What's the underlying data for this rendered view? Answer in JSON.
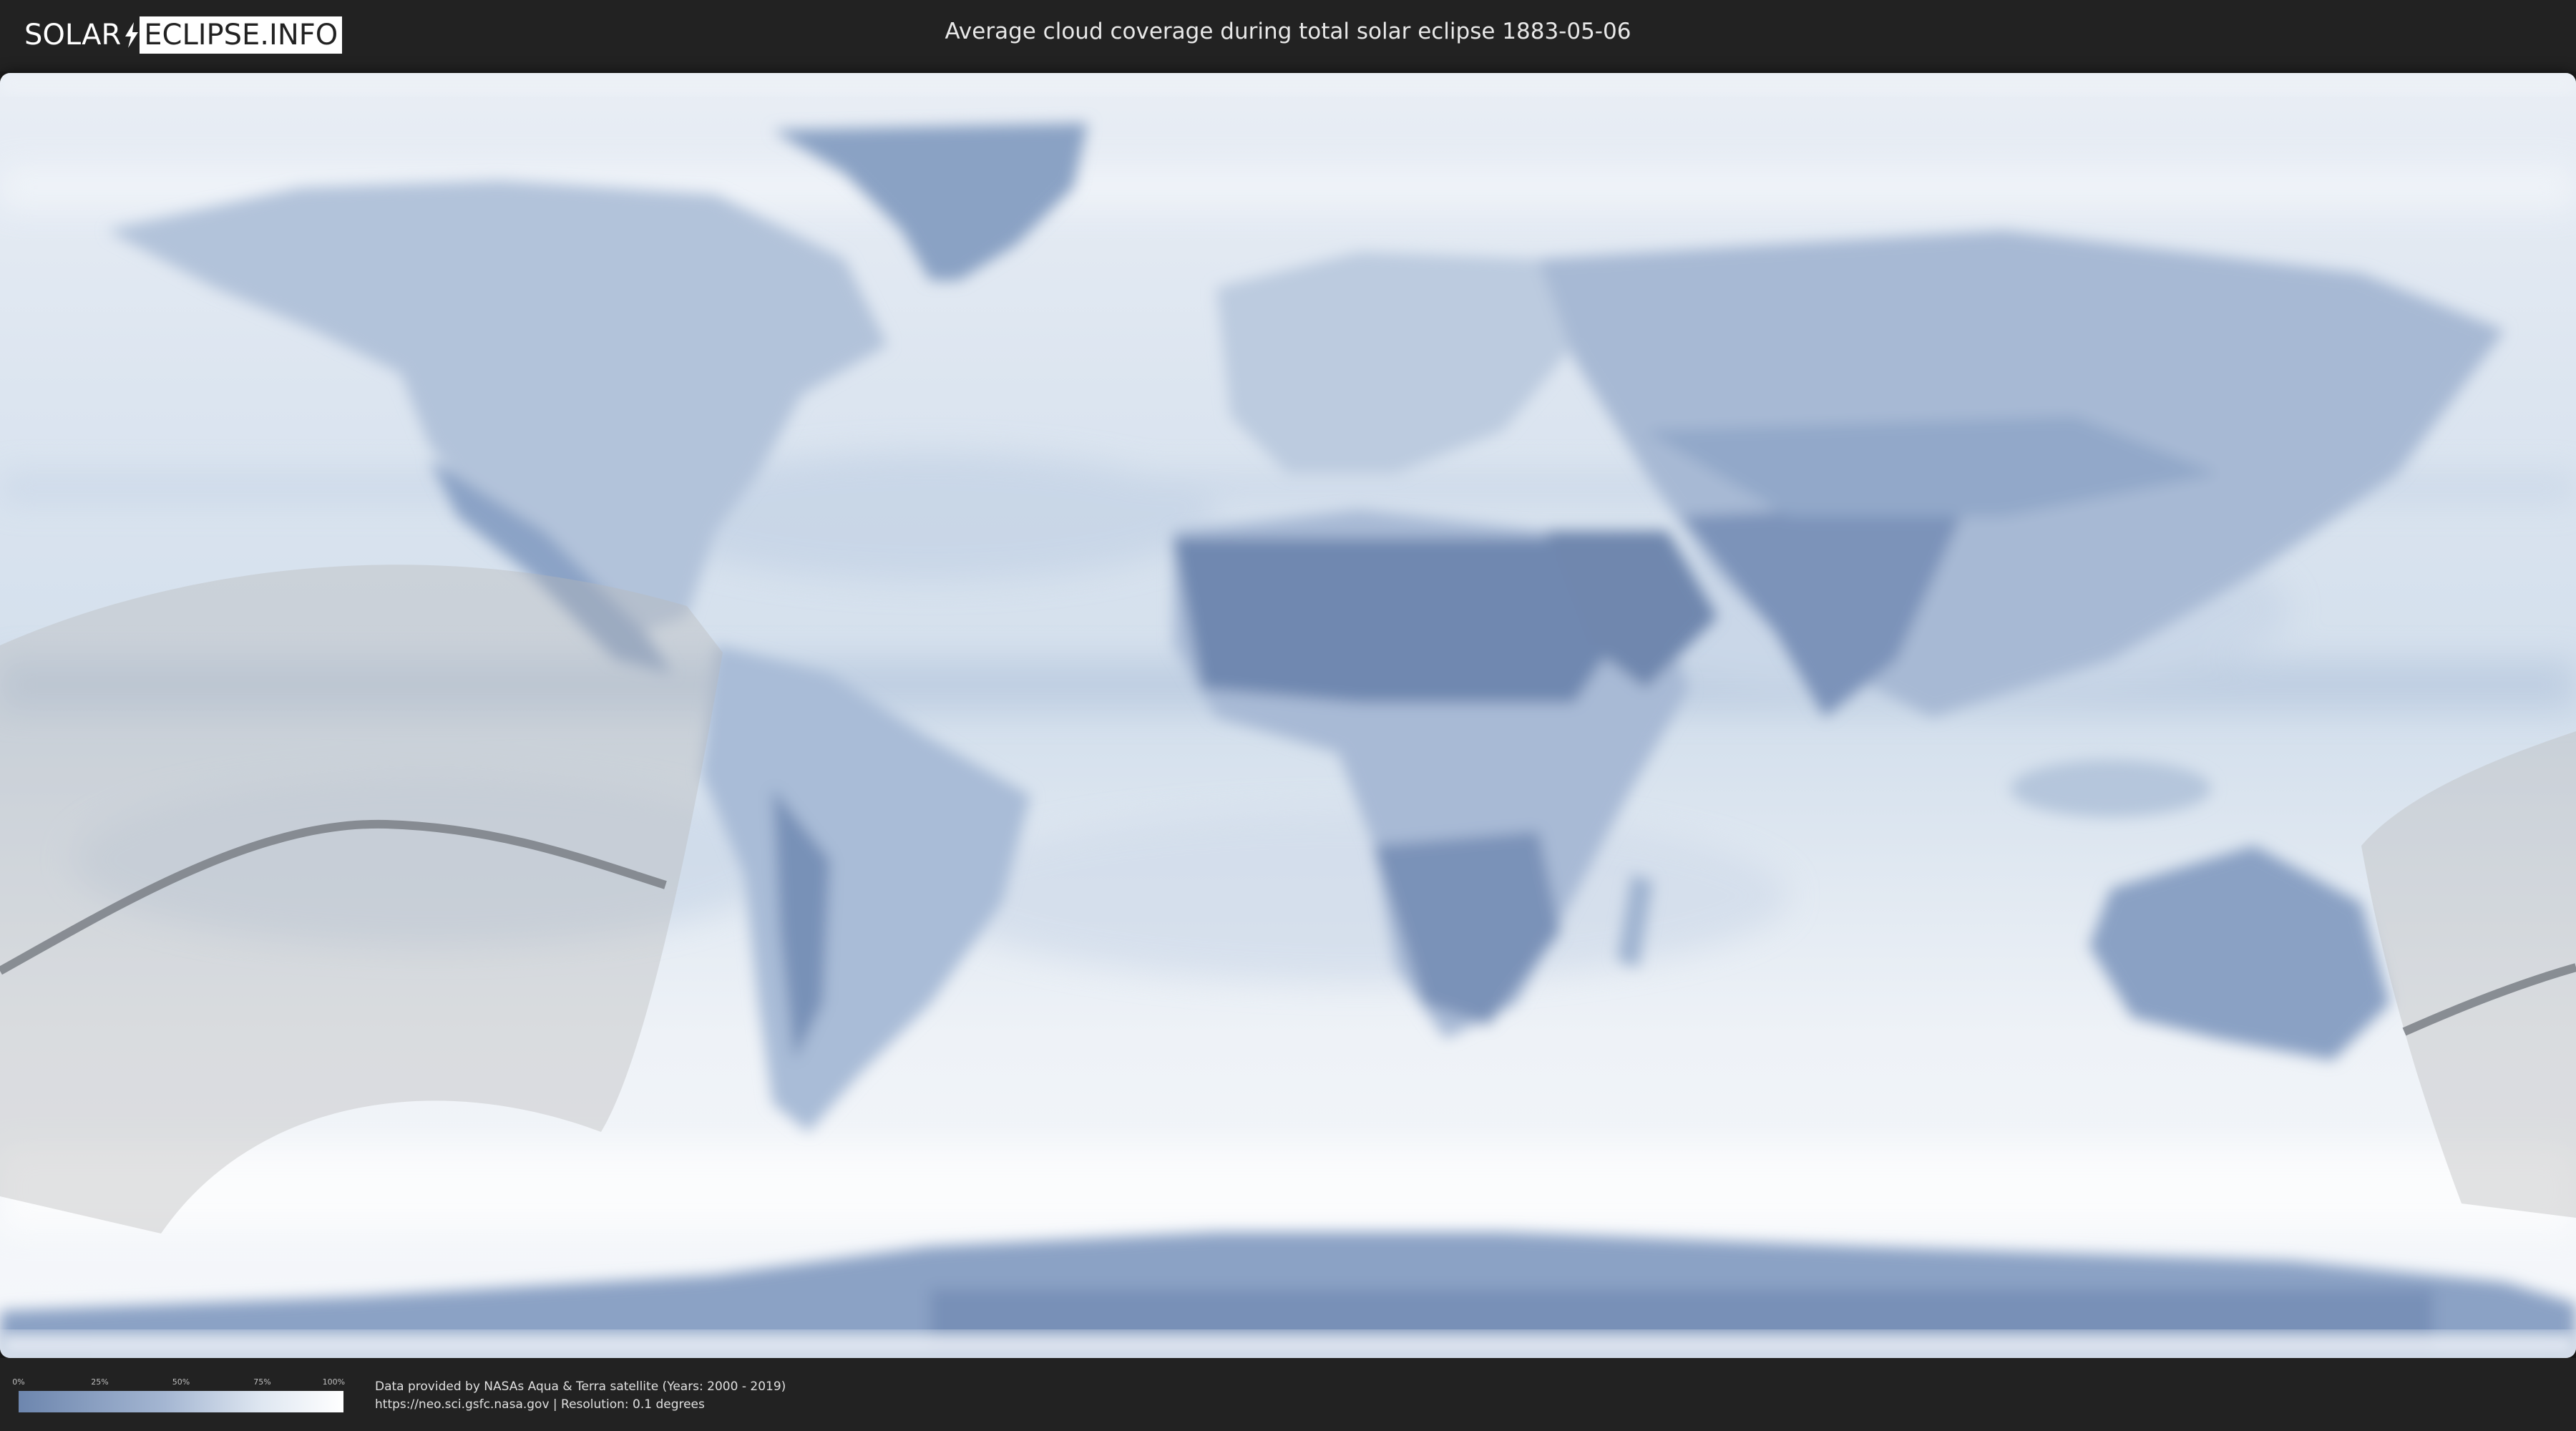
{
  "header": {
    "logo_left": "SOLAR",
    "logo_right": "ECLIPSE.INFO",
    "title": "Average cloud coverage during total solar eclipse 1883-05-06"
  },
  "legend": {
    "ticks": [
      "0%",
      "25%",
      "50%",
      "75%",
      "100%"
    ],
    "color_low": "#6d86ae",
    "color_high": "#ffffff"
  },
  "footer": {
    "credit_line1": "Data provided by NASAs Aqua & Terra satellite (Years: 2000 - 2019)",
    "credit_line2": "https://neo.sci.gsfc.nasa.gov | Resolution: 0.1 degrees"
  },
  "map": {
    "ocean_color": "#d9e4f0",
    "land_cloudfree_color": "#7790b6",
    "shadow_zone_color": "#c9c9c9"
  }
}
